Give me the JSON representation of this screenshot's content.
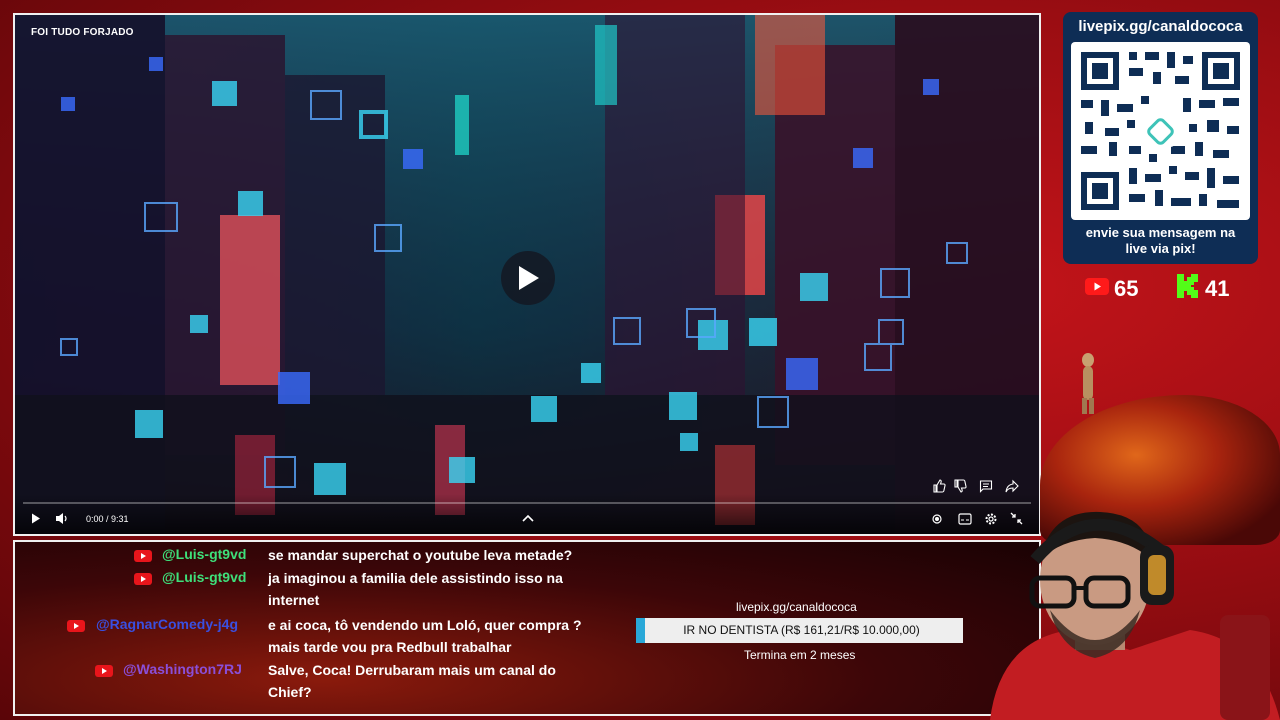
{
  "video": {
    "title": "FOI TUDO FORJADO",
    "time": "0:00 / 9:31",
    "progress_fraction": 0.0
  },
  "pix": {
    "url": "livepix.gg/canaldococa",
    "caption_line1": "envie sua mensagem na",
    "caption_line2": "live via pix!"
  },
  "counters": {
    "youtube": "65",
    "kick": "41"
  },
  "chat": {
    "messages": [
      {
        "user": "@Luis-gt9vd",
        "color": "#3ee07a",
        "line1": "se mandar superchat o youtube leva metade?",
        "line2": ""
      },
      {
        "user": "@Luis-gt9vd",
        "color": "#3ee07a",
        "line1": "ja imaginou a familia dele assistindo isso na",
        "line2": "internet"
      },
      {
        "user": "@RagnarComedy-j4g",
        "color": "#3a4fe0",
        "line1": "e ai coca, tô vendendo um Loló, quer compra ?",
        "line2": "mais tarde vou pra Redbull trabalhar"
      },
      {
        "user": "@Washington7RJ",
        "color": "#8a4fd8",
        "line1": "Salve, Coca! Derrubaram mais um canal do",
        "line2": "Chief?"
      }
    ]
  },
  "goal": {
    "url": "livepix.gg/canaldococa",
    "label": "IR NO DENTISTA (R$ 161,21/R$ 10.000,00)",
    "fraction": 0.016,
    "ends": "Termina em 2 meses",
    "accent": "#29a8d8"
  }
}
